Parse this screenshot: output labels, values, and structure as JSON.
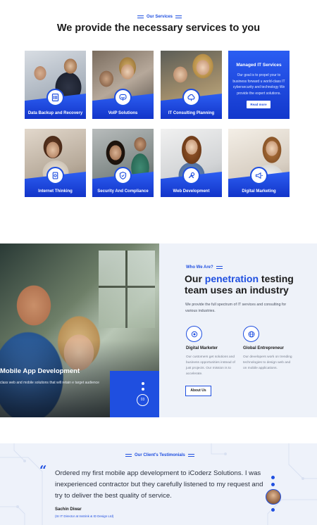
{
  "services": {
    "eyebrow": "Our Services",
    "title": "We provide the necessary services to you",
    "cards": [
      {
        "label": "Data Backup and Recovery",
        "icon": "database-icon"
      },
      {
        "label": "VoIP Solutions",
        "icon": "phone-icon"
      },
      {
        "label": "IT Consulting Planning",
        "icon": "cloud-icon"
      },
      {
        "label": "Internet Thinking",
        "icon": "gear-icon"
      },
      {
        "label": "Security And Compliance",
        "icon": "shield-icon"
      },
      {
        "label": "Web Development",
        "icon": "wrench-icon"
      },
      {
        "label": "Digital Marketing",
        "icon": "megaphone-icon"
      }
    ],
    "feature": {
      "title": "Managed IT Services",
      "text": "Our goal is to propel your to business forward u world-class IT cybersecurity and technology We provide the expert solutions.",
      "button": "Read more"
    }
  },
  "who": {
    "slide_title": "Mobile App Development",
    "slide_desc": "class web and mobile solutions that will retain e target audience",
    "slide_number": "03",
    "eyebrow": "Who We Are?",
    "title_pre": "Our ",
    "title_highlight": "penetration",
    "title_post": " testing team uses an industry",
    "text": "We provide the full spectrum of IT services and consulting for various industries.",
    "features": [
      {
        "title": "Digital Marketer",
        "text": "Our customers get solutions and business opportunities instead of just projects. Our mission is to accelerate.",
        "icon": "target-icon"
      },
      {
        "title": "Global Entrepreneur",
        "text": "Our developers work on trending technologies to design web and on mobile applications.",
        "icon": "globe-icon"
      }
    ],
    "button": "About Us"
  },
  "testimonials": {
    "eyebrow": "Our Client's Testimonials",
    "quote": "Ordered my first mobile app development to iCoderz Solutions. I was inexperienced contractor but they carefully listened to my request and try to deliver the best quality of service.",
    "author": "Sachin Diwar",
    "role": "(Sr IT Director at Instrink & ID Design Ltd)"
  },
  "colors": {
    "accent": "#1f4fe0",
    "light_bg": "#eef2f9"
  }
}
